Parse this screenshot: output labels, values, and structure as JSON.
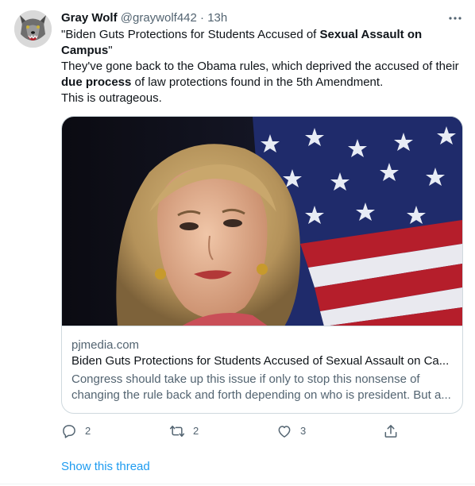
{
  "tweet": {
    "author_name": "Gray Wolf",
    "handle_time": "@graywolf442 · 13h",
    "text": {
      "line1_pre": "\"Biden Guts Protections for Students Accused of ",
      "line1_bold": "Sexual Assault on",
      "line2_bold": "Campus",
      "line2_post": "\"",
      "line3": "They've gone back to the Obama rules, which deprived the accused of their",
      "line4_bold": "due process",
      "line4_post": " of law protections found in the 5th Amendment.",
      "line5": "This is outrageous."
    },
    "card": {
      "domain": "pjmedia.com",
      "title": "Biden Guts Protections for Students Accused of Sexual Assault on Ca...",
      "description_line1": "Congress should take up this issue if only to stop this nonsense of",
      "description_line2": "changing the rule back and forth depending on who is president. But a..."
    },
    "actions": {
      "reply_count": "2",
      "retweet_count": "2",
      "like_count": "3"
    },
    "show_thread": "Show this thread"
  },
  "icons": {
    "reply": "reply-icon",
    "retweet": "retweet-icon",
    "like": "heart-icon",
    "share": "share-icon",
    "more": "more-icon"
  },
  "colors": {
    "link": "#1d9bf0",
    "secondary_text": "#536471",
    "primary_text": "#0f1419",
    "border": "#cfd9de"
  }
}
